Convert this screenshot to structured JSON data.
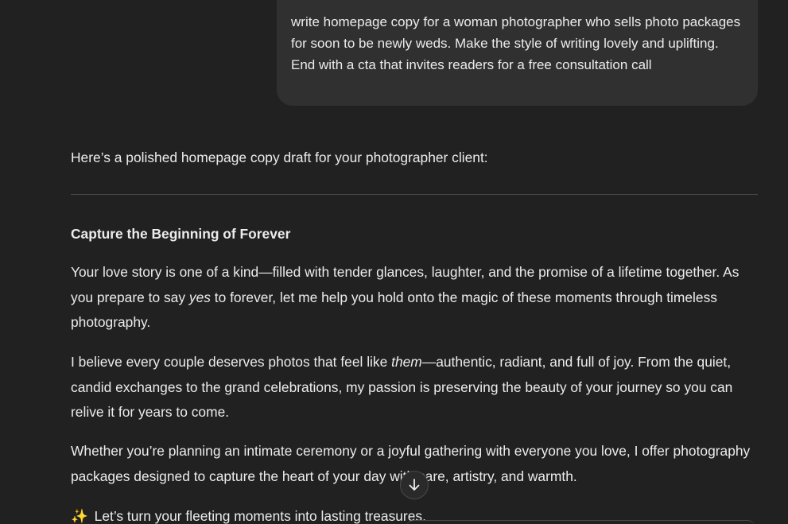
{
  "user_message": {
    "text": "write homepage copy for a woman photographer who sells photo packages for soon to be newly weds. Make the style of writing lovely and uplifting. End with a cta that invites readers for a free consultation call"
  },
  "assistant": {
    "intro": "Here’s a polished homepage copy draft for your photographer client:",
    "heading": "Capture the Beginning of Forever",
    "p1_a": "Your love story is one of a kind—filled with tender glances, laughter, and the promise of a lifetime together. As you prepare to say ",
    "p1_em": "yes",
    "p1_b": " to forever, let me help you hold onto the magic of these moments through timeless photography.",
    "p2_a": "I believe every couple deserves photos that feel like ",
    "p2_em": "them",
    "p2_b": "—authentic, radiant, and full of joy. From the quiet, candid exchanges to the grand celebrations, my passion is preserving the beauty of your journey so you can relive it for years to come.",
    "p3": "Whether you’re planning an intimate ceremony or a joyful gathering with everyone you love, I offer photography packages designed to capture the heart of your day with care, artistry, and warmth.",
    "p4_icon": "sparkles-icon",
    "p4": "Let’s turn your fleeting moments into lasting treasures."
  },
  "controls": {
    "scroll_down_icon": "arrow-down-icon"
  }
}
